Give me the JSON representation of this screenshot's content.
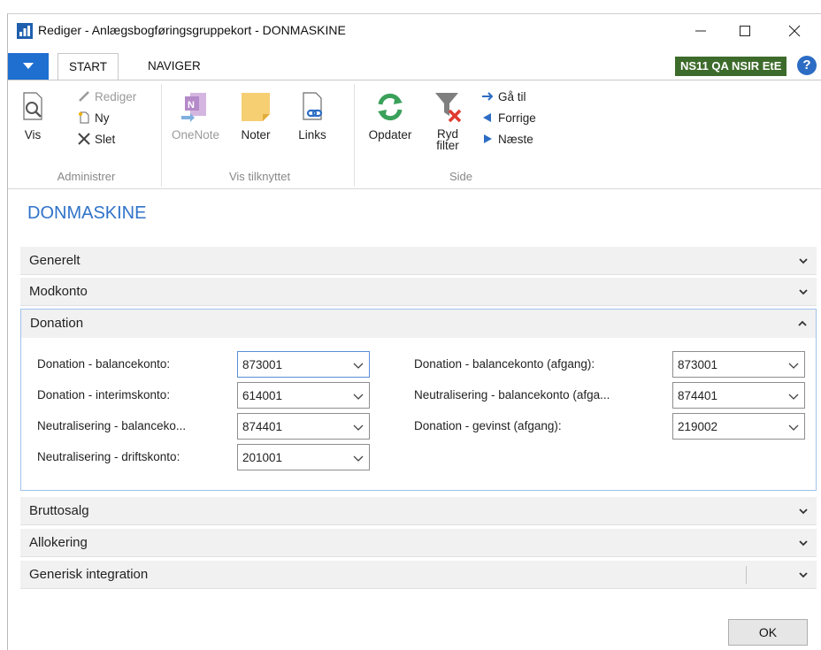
{
  "window": {
    "title": "Rediger - Anlægsbogføringsgruppekort - DONMASKINE"
  },
  "tabs": {
    "start": "START",
    "naviger": "NAVIGER"
  },
  "company_badge": "NS11 QA NSIR EtE",
  "help_label": "?",
  "ribbon": {
    "administrer": {
      "label": "Administrer",
      "vis": "Vis",
      "rediger": "Rediger",
      "ny": "Ny",
      "slet": "Slet"
    },
    "vis_tilknyttet": {
      "label": "Vis tilknyttet",
      "onenote": "OneNote",
      "noter": "Noter",
      "links": "Links"
    },
    "side": {
      "label": "Side",
      "opdater": "Opdater",
      "ryd_filter_line1": "Ryd",
      "ryd_filter_line2": "filter",
      "ga_til": "Gå til",
      "forrige": "Forrige",
      "naeste": "Næste"
    }
  },
  "page_title": "DONMASKINE",
  "fasttabs": {
    "generelt": "Generelt",
    "modkonto": "Modkonto",
    "donation": "Donation",
    "bruttosalg": "Bruttosalg",
    "allokering": "Allokering",
    "generisk": "Generisk integration"
  },
  "donation_fields": {
    "left": [
      {
        "label": "Donation - balancekonto:",
        "value": "873001"
      },
      {
        "label": "Donation - interimskonto:",
        "value": "614001"
      },
      {
        "label": "Neutralisering - balanceko...",
        "value": "874401"
      },
      {
        "label": "Neutralisering - driftskonto:",
        "value": "201001"
      }
    ],
    "right": [
      {
        "label": "Donation - balancekonto (afgang):",
        "value": "873001"
      },
      {
        "label": "Neutralisering - balancekonto (afga...",
        "value": "874401"
      },
      {
        "label": "Donation - gevinst (afgang):",
        "value": "219002"
      }
    ]
  },
  "ok_label": "OK",
  "colors": {
    "accent": "#2f73c9",
    "app_menu": "#1e6fd0",
    "badge": "#3d6b2b"
  }
}
